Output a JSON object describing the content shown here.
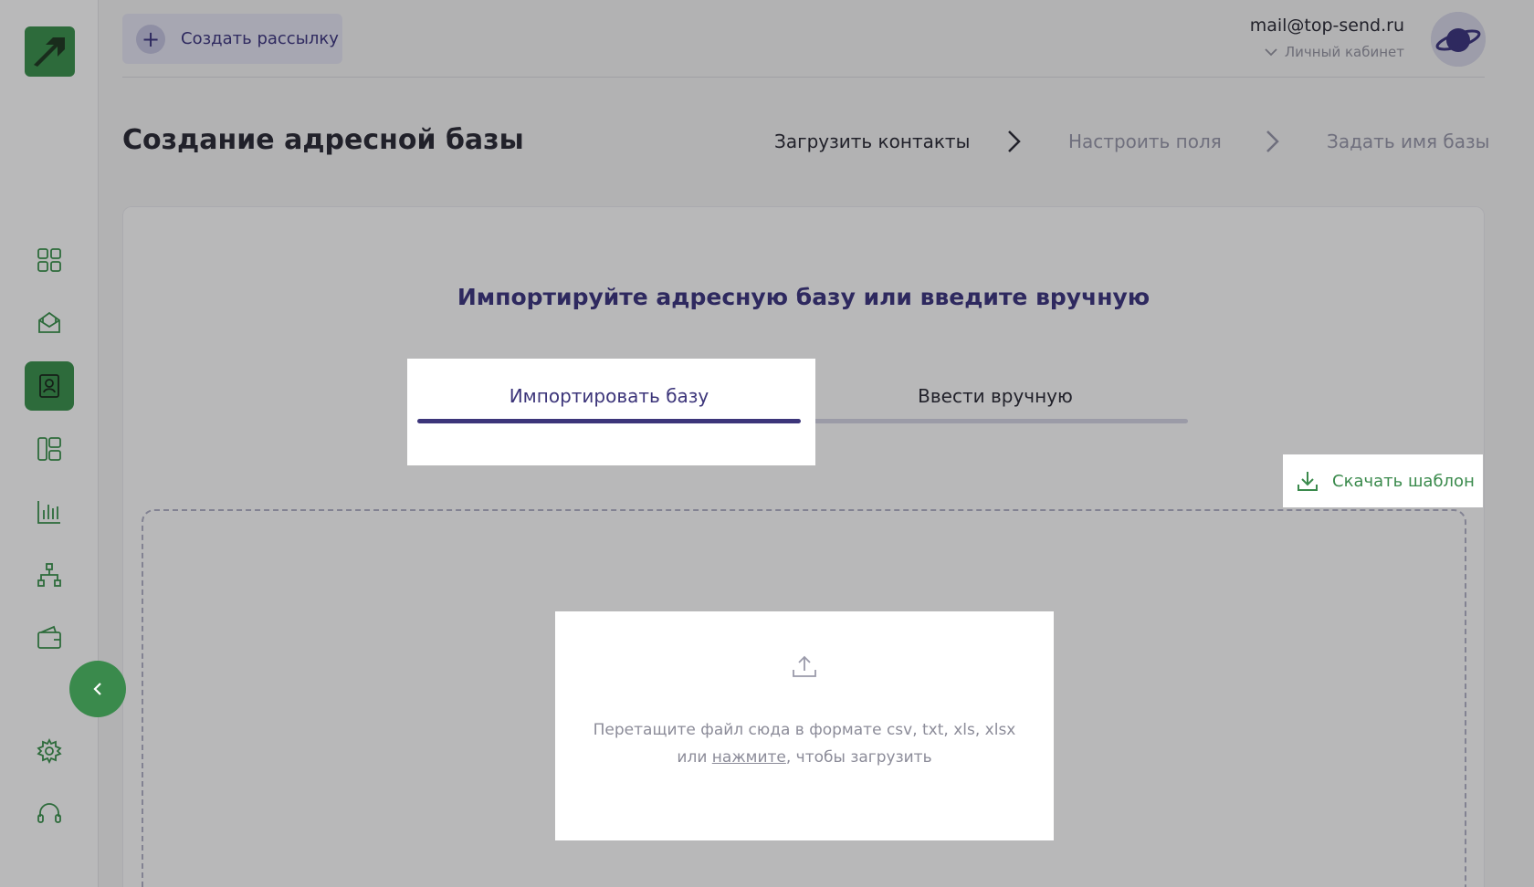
{
  "header": {
    "create_button_label": "Создать рассылку",
    "user_email": "mail@top-send.ru",
    "cabinet_label": "Личный кабинет"
  },
  "page": {
    "title": "Создание адресной базы",
    "steps": [
      {
        "label": "Загрузить контакты",
        "state": "active"
      },
      {
        "label": "Настроить поля",
        "state": "inactive"
      },
      {
        "label": "Задать имя базы",
        "state": "inactive"
      }
    ]
  },
  "card": {
    "heading": "Импортируйте адресную базу или введите вручную",
    "tabs": [
      {
        "label": "Импортировать базу",
        "active": true
      },
      {
        "label": "Ввести вручную",
        "active": false
      }
    ],
    "download_template_label": "Скачать шаблон",
    "dropzone": {
      "line1": "Перетащите файл сюда в формате csv, txt, xls, xlsx",
      "line2_prefix": "или ",
      "line2_link": "нажмите",
      "line2_suffix": ", чтобы загрузить"
    }
  },
  "sidebar": {
    "items": [
      {
        "icon": "dashboard-icon"
      },
      {
        "icon": "mail-open-icon"
      },
      {
        "icon": "contacts-icon",
        "active": true
      },
      {
        "icon": "templates-icon"
      },
      {
        "icon": "stats-chart-icon"
      },
      {
        "icon": "scenario-tree-icon"
      },
      {
        "icon": "wallet-icon"
      },
      {
        "icon": "settings-gear-icon"
      },
      {
        "icon": "support-headset-icon"
      }
    ]
  },
  "colors": {
    "brand_green": "#3a8a4c",
    "accent_purple": "#3c357a"
  }
}
